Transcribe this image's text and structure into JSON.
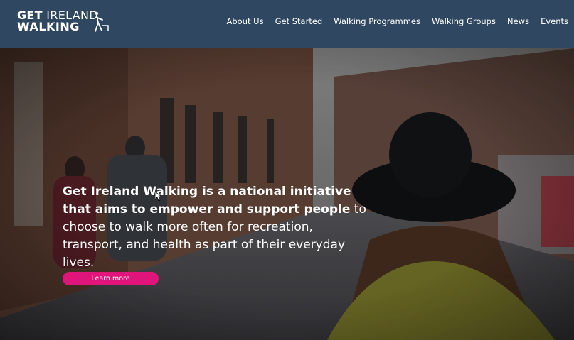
{
  "logo": {
    "line1_bold": "GET",
    "line1_light": "IRELAND",
    "line2": "WALKING"
  },
  "nav": {
    "items": [
      {
        "label": "About Us"
      },
      {
        "label": "Get Started"
      },
      {
        "label": "Walking Programmes"
      },
      {
        "label": "Walking Groups"
      },
      {
        "label": "News"
      },
      {
        "label": "Events"
      }
    ]
  },
  "hero": {
    "headline_bold": "Get Ireland Walking is a national initiative that aims to empower and support people",
    "headline_rest": " to choose to walk more often for recreation, transport, and health as part of their everyday lives.",
    "cta_label": "Learn more"
  },
  "colors": {
    "header_bg": "#2f4760",
    "cta_bg": "#e0157b"
  }
}
